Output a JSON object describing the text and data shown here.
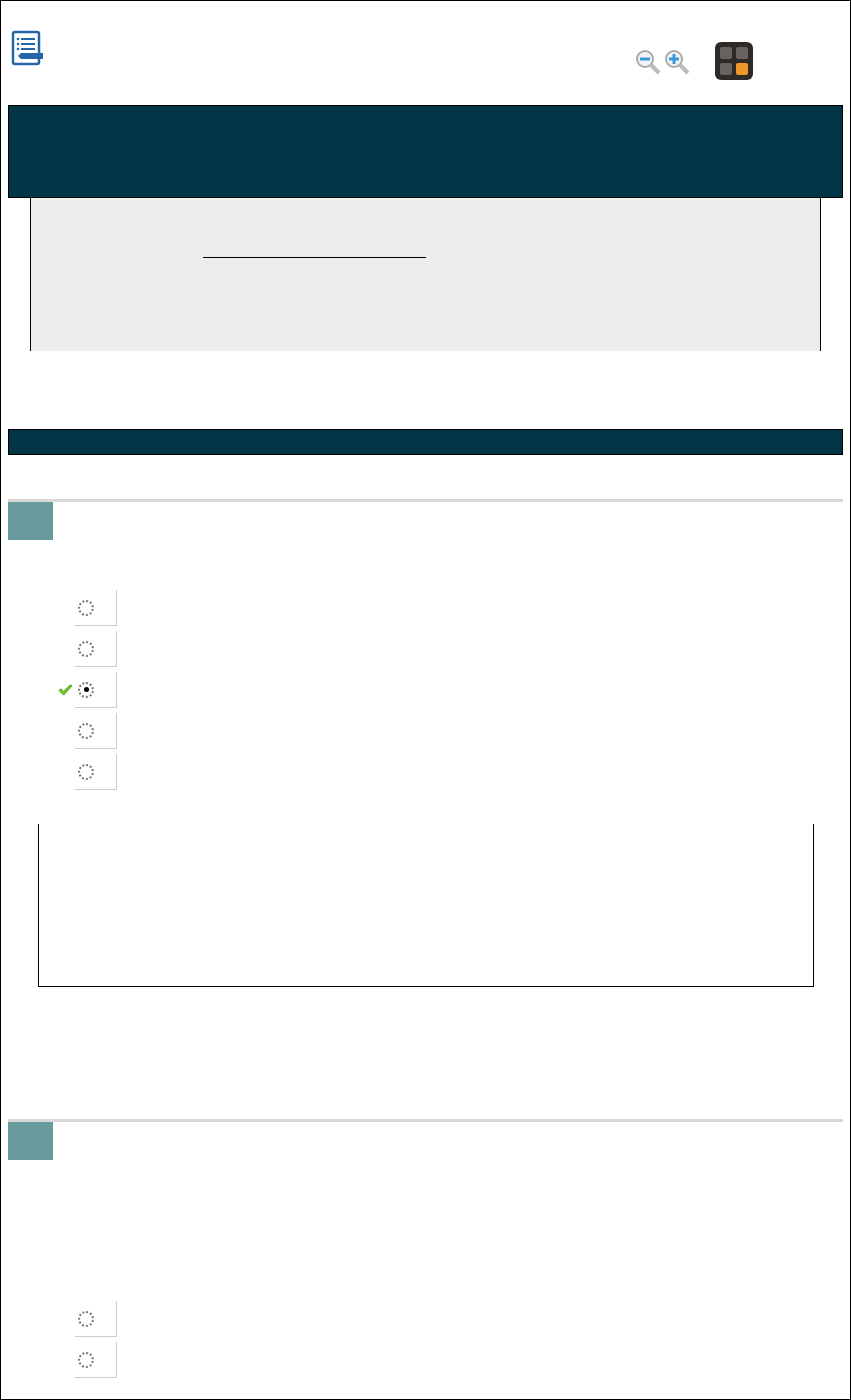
{
  "questions": [
    {
      "options": [
        {
          "selected": false,
          "correct": false
        },
        {
          "selected": false,
          "correct": false
        },
        {
          "selected": true,
          "correct": true
        },
        {
          "selected": false,
          "correct": false
        },
        {
          "selected": false,
          "correct": false
        }
      ],
      "explanation": true
    },
    {
      "options": [
        {
          "selected": false,
          "correct": false
        },
        {
          "selected": false,
          "correct": false
        }
      ],
      "explanation": false
    }
  ]
}
